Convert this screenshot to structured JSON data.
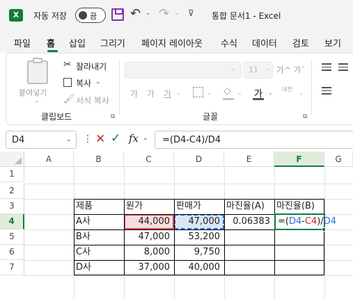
{
  "app": {
    "logo": "X",
    "autosave_label": "자동 저장",
    "autosave_state": "끔",
    "document_title": "통합 문서1  -  Excel"
  },
  "tabs": [
    "파일",
    "홈",
    "삽입",
    "그리기",
    "페이지 레이아웃",
    "수식",
    "데이터",
    "검토",
    "보기"
  ],
  "active_tab": "홈",
  "ribbon": {
    "clipboard": {
      "paste_label": "붙여넣기",
      "cut_label": "잘라내기",
      "copy_label": "복사",
      "format_painter_label": "서식 복사",
      "group_label": "클립보드"
    },
    "font": {
      "font_name": "",
      "font_size": "11",
      "bold": "가",
      "italic": "가",
      "underline": "가",
      "grow_font": "가^",
      "shrink_font": "가ˇ",
      "font_color": "가",
      "phonetic": "내천",
      "group_label": "글꼴"
    }
  },
  "formula_bar": {
    "name_box": "D4",
    "formula": "=(D4-C4)/D4"
  },
  "columns": [
    "A",
    "B",
    "C",
    "D",
    "E",
    "F",
    "G"
  ],
  "selected_column": "F",
  "rows": [
    "1",
    "2",
    "3",
    "4",
    "5",
    "6",
    "7"
  ],
  "selected_row": "4",
  "table": {
    "headers": [
      "제품",
      "원가",
      "판매가",
      "마진율(A)",
      "마진율(B)"
    ],
    "rows": [
      {
        "product": "A사",
        "cost": "44,000",
        "price": "47,000",
        "margin_a": "0.06383",
        "margin_b": ""
      },
      {
        "product": "B사",
        "cost": "47,000",
        "price": "53,200",
        "margin_a": "",
        "margin_b": ""
      },
      {
        "product": "C사",
        "cost": "8,000",
        "price": "9,750",
        "margin_a": "",
        "margin_b": ""
      },
      {
        "product": "D사",
        "cost": "37,000",
        "price": "40,000",
        "margin_a": "",
        "margin_b": ""
      }
    ]
  },
  "editing_cell": {
    "ref": "F4",
    "parts": [
      "=(",
      "D4",
      "-",
      "C4",
      ")/",
      "D4"
    ]
  },
  "colors": {
    "excel_green": "#107c41",
    "ref_red": "#c4262e",
    "ref_blue": "#2b6cd4"
  }
}
